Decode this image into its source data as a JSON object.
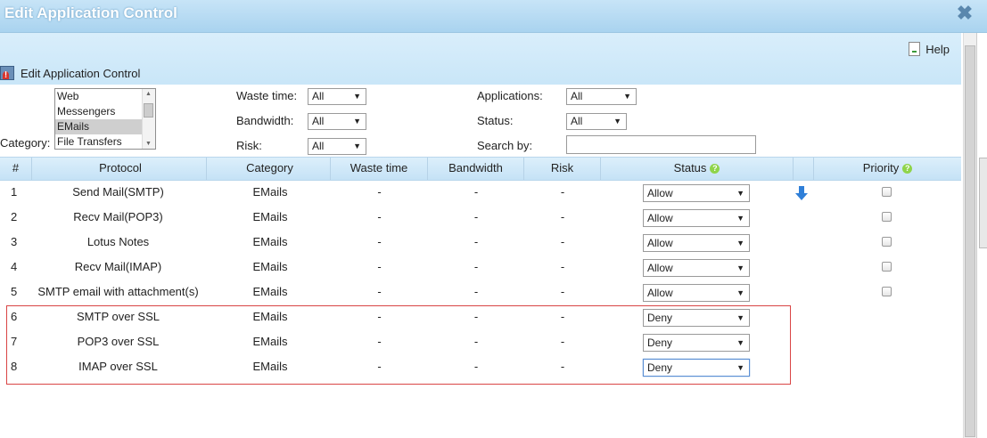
{
  "window": {
    "title": "Edit Application Control",
    "close_icon": "close-x-icon"
  },
  "header": {
    "help_label": "Help",
    "section_title": "Edit Application Control"
  },
  "filters": {
    "category_label": "Category:",
    "category_options": [
      "Web",
      "Messengers",
      "EMails",
      "File Transfers"
    ],
    "category_selected": "EMails",
    "waste_time_label": "Waste time:",
    "waste_time_value": "All",
    "bandwidth_label": "Bandwidth:",
    "bandwidth_value": "All",
    "risk_label": "Risk:",
    "risk_value": "All",
    "applications_label": "Applications:",
    "applications_value": "All",
    "status_label": "Status:",
    "status_value": "All",
    "search_label": "Search by:",
    "search_value": ""
  },
  "table": {
    "headers": {
      "num": "#",
      "protocol": "Protocol",
      "category": "Category",
      "waste_time": "Waste time",
      "bandwidth": "Bandwidth",
      "risk": "Risk",
      "status": "Status",
      "priority": "Priority",
      "help_mark": "?"
    },
    "rows": [
      {
        "num": "1",
        "protocol": "Send Mail(SMTP)",
        "category": "EMails",
        "waste_time": "-",
        "bandwidth": "-",
        "risk": "-",
        "status": "Allow",
        "priority_checked": false
      },
      {
        "num": "2",
        "protocol": "Recv Mail(POP3)",
        "category": "EMails",
        "waste_time": "-",
        "bandwidth": "-",
        "risk": "-",
        "status": "Allow",
        "priority_checked": false
      },
      {
        "num": "3",
        "protocol": "Lotus Notes",
        "category": "EMails",
        "waste_time": "-",
        "bandwidth": "-",
        "risk": "-",
        "status": "Allow",
        "priority_checked": false
      },
      {
        "num": "4",
        "protocol": "Recv Mail(IMAP)",
        "category": "EMails",
        "waste_time": "-",
        "bandwidth": "-",
        "risk": "-",
        "status": "Allow",
        "priority_checked": false
      },
      {
        "num": "5",
        "protocol": "SMTP email with attachment(s)",
        "category": "EMails",
        "waste_time": "-",
        "bandwidth": "-",
        "risk": "-",
        "status": "Allow",
        "priority_checked": false
      },
      {
        "num": "6",
        "protocol": "SMTP over SSL",
        "category": "EMails",
        "waste_time": "-",
        "bandwidth": "-",
        "risk": "-",
        "status": "Deny"
      },
      {
        "num": "7",
        "protocol": "POP3 over SSL",
        "category": "EMails",
        "waste_time": "-",
        "bandwidth": "-",
        "risk": "-",
        "status": "Deny"
      },
      {
        "num": "8",
        "protocol": "IMAP over SSL",
        "category": "EMails",
        "waste_time": "-",
        "bandwidth": "-",
        "risk": "-",
        "status": "Deny"
      }
    ]
  },
  "colors": {
    "header_bg": "#c7e4f7",
    "highlight_border": "#d94545",
    "arrow_blue": "#2f7fd8"
  }
}
